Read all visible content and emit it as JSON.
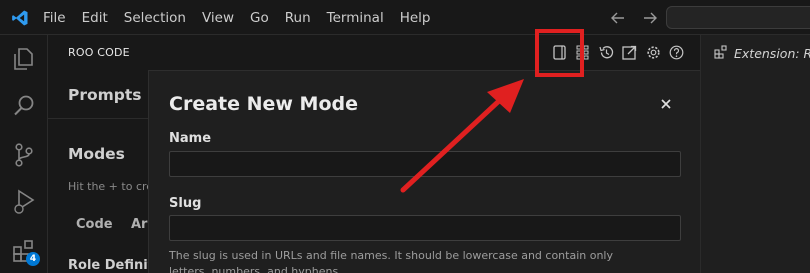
{
  "menu": [
    "File",
    "Edit",
    "Selection",
    "View",
    "Go",
    "Run",
    "Terminal",
    "Help"
  ],
  "activity_bar": {
    "icons": [
      "explorer-icon",
      "search-icon",
      "source-control-icon",
      "run-debug-icon",
      "extensions-icon"
    ],
    "extensions_badge": "4"
  },
  "panel": {
    "title": "ROO CODE",
    "header_icons": [
      "prompts-icon",
      "mcp-servers-icon",
      "history-icon",
      "popout-icon",
      "settings-icon",
      "help-icon"
    ],
    "prompts_title": "Prompts",
    "modes_title": "Modes",
    "modes_hint": "Hit the + to cre",
    "mode_tabs": [
      "Code",
      "Ar"
    ],
    "role_definition": "Role Definitio"
  },
  "modal": {
    "title": "Create New Mode",
    "name_label": "Name",
    "name_value": "",
    "slug_label": "Slug",
    "slug_value": "",
    "slug_help": "The slug is used in URLs and file names. It should be lowercase and contain only letters, numbers, and hyphens."
  },
  "editor_tab": {
    "label": "Extension: Roo"
  },
  "colors": {
    "annotation": "#e02020",
    "accent": "#0078d4"
  }
}
